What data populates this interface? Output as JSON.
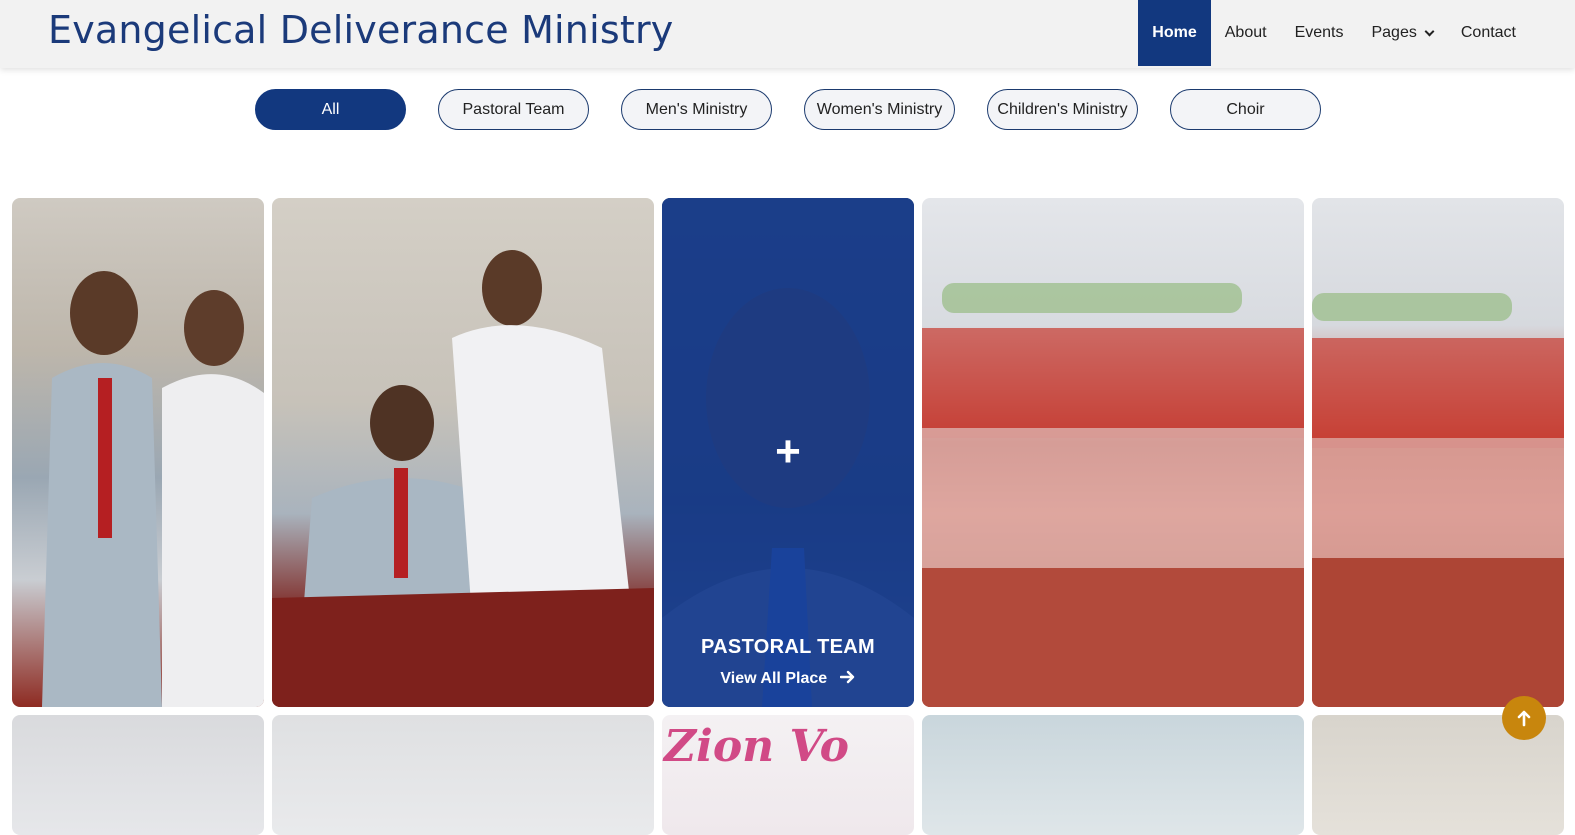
{
  "header": {
    "brand": "Evangelical Deliverance Ministry",
    "nav": [
      {
        "label": "Home",
        "active": true
      },
      {
        "label": "About"
      },
      {
        "label": "Events"
      },
      {
        "label": "Pages"
      },
      {
        "label": "Contact"
      }
    ]
  },
  "filters": [
    {
      "label": "All",
      "active": true
    },
    {
      "label": "Pastoral Team"
    },
    {
      "label": "Men's Ministry"
    },
    {
      "label": "Women's Ministry"
    },
    {
      "label": "Children's Ministry"
    },
    {
      "label": "Choir"
    }
  ],
  "gallery": {
    "featured": {
      "plus": "+",
      "title": "PASTORAL TEAM",
      "link": "View All Place"
    },
    "sign_text": "Zion Vo"
  },
  "icons": {
    "pages_dropdown": "chevron-down-icon",
    "featured_link": "arrow-right-icon",
    "back_to_top": "arrow-up-icon"
  },
  "colors": {
    "brand": "#1b3a7a",
    "nav_active": "#12387f",
    "overlay": "#1840a0",
    "back_to_top": "#c8860d"
  }
}
